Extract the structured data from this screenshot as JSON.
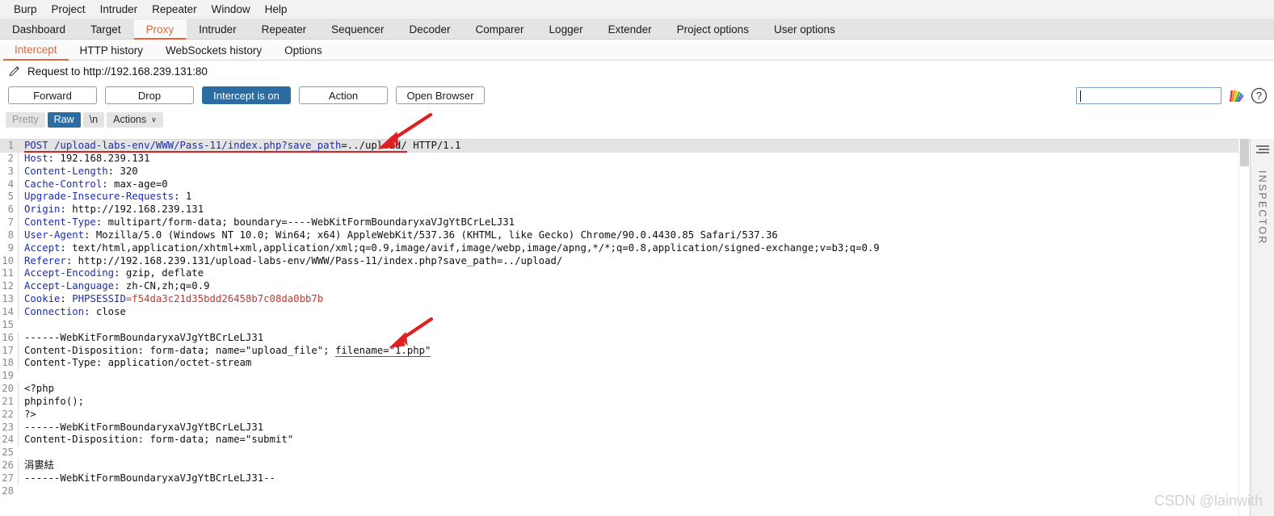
{
  "menubar": {
    "items": [
      "Burp",
      "Project",
      "Intruder",
      "Repeater",
      "Window",
      "Help"
    ]
  },
  "main_tabs": {
    "active": "Proxy",
    "items": [
      "Dashboard",
      "Target",
      "Proxy",
      "Intruder",
      "Repeater",
      "Sequencer",
      "Decoder",
      "Comparer",
      "Logger",
      "Extender",
      "Project options",
      "User options"
    ]
  },
  "sub_tabs": {
    "active": "Intercept",
    "items": [
      "Intercept",
      "HTTP history",
      "WebSockets history",
      "Options"
    ]
  },
  "request_title": {
    "icon": "pencil-icon",
    "text": "Request to http://192.168.239.131:80"
  },
  "buttons": {
    "forward": "Forward",
    "drop": "Drop",
    "intercept": "Intercept is on",
    "action": "Action",
    "open_browser": "Open Browser"
  },
  "search": {
    "value": "",
    "placeholder": "",
    "rainbow_icon": "rainbow-fan-icon",
    "help_icon": "help-question-icon"
  },
  "editor_toolbar": {
    "pretty": "Pretty",
    "raw": "Raw",
    "newline": "\\n",
    "actions": "Actions",
    "chevron": "∨",
    "active": "Raw"
  },
  "inspector": {
    "label": "INSPECTOR",
    "icon": "panel-lines-icon"
  },
  "colors": {
    "accent": "#e8653b",
    "primary_button": "#2b6ca3",
    "header_name": "#1c2db0",
    "cookie_value": "#c0392b",
    "annotation": "#e02020"
  },
  "watermark": "CSDN @lainwith",
  "request_lines": [
    {
      "n": 1,
      "highlight": true,
      "segments": [
        {
          "t": "POST /upload-labs-env/WWW/Pass-11/index.php?",
          "c": "hdr",
          "u": true
        },
        {
          "t": "save_path",
          "c": "hdr",
          "u": true
        },
        {
          "t": "=../upload/",
          "c": "val",
          "u": true
        },
        {
          "t": " HTTP/1.1",
          "c": "val",
          "u": false
        }
      ]
    },
    {
      "n": 2,
      "segments": [
        {
          "t": "Host",
          "c": "hdr"
        },
        {
          "t": ": 192.168.239.131",
          "c": "val"
        }
      ]
    },
    {
      "n": 3,
      "segments": [
        {
          "t": "Content-Length",
          "c": "hdr"
        },
        {
          "t": ": 320",
          "c": "val"
        }
      ]
    },
    {
      "n": 4,
      "segments": [
        {
          "t": "Cache-Control",
          "c": "hdr"
        },
        {
          "t": ": max-age=0",
          "c": "val"
        }
      ]
    },
    {
      "n": 5,
      "segments": [
        {
          "t": "Upgrade-Insecure-Requests",
          "c": "hdr"
        },
        {
          "t": ": 1",
          "c": "val"
        }
      ]
    },
    {
      "n": 6,
      "segments": [
        {
          "t": "Origin",
          "c": "hdr"
        },
        {
          "t": ": http://192.168.239.131",
          "c": "val"
        }
      ]
    },
    {
      "n": 7,
      "segments": [
        {
          "t": "Content-Type",
          "c": "hdr"
        },
        {
          "t": ": multipart/form-data; boundary=----WebKitFormBoundaryxaVJgYtBCrLeLJ31",
          "c": "val"
        }
      ]
    },
    {
      "n": 8,
      "segments": [
        {
          "t": "User-Agent",
          "c": "hdr"
        },
        {
          "t": ": Mozilla/5.0 (Windows NT 10.0; Win64; x64) AppleWebKit/537.36 (KHTML, like Gecko) Chrome/90.0.4430.85 Safari/537.36",
          "c": "val"
        }
      ]
    },
    {
      "n": 9,
      "segments": [
        {
          "t": "Accept",
          "c": "hdr"
        },
        {
          "t": ": text/html,application/xhtml+xml,application/xml;q=0.9,image/avif,image/webp,image/apng,*/*;q=0.8,application/signed-exchange;v=b3;q=0.9",
          "c": "val"
        }
      ]
    },
    {
      "n": 10,
      "segments": [
        {
          "t": "Referer",
          "c": "hdr"
        },
        {
          "t": ": http://192.168.239.131/upload-labs-env/WWW/Pass-11/index.php?save_path=../upload/",
          "c": "val"
        }
      ]
    },
    {
      "n": 11,
      "segments": [
        {
          "t": "Accept-Encoding",
          "c": "hdr"
        },
        {
          "t": ": gzip, deflate",
          "c": "val"
        }
      ]
    },
    {
      "n": 12,
      "segments": [
        {
          "t": "Accept-Language",
          "c": "hdr"
        },
        {
          "t": ": zh-CN,zh;q=0.9",
          "c": "val"
        }
      ]
    },
    {
      "n": 13,
      "segments": [
        {
          "t": "Cookie",
          "c": "hdr"
        },
        {
          "t": ": ",
          "c": "val"
        },
        {
          "t": "PHPSESSID",
          "c": "hdr"
        },
        {
          "t": "=f54da3c21d35bdd26458b7c08da0bb7b",
          "c": "red"
        }
      ]
    },
    {
      "n": 14,
      "segments": [
        {
          "t": "Connection",
          "c": "hdr"
        },
        {
          "t": ": close",
          "c": "val"
        }
      ]
    },
    {
      "n": 15,
      "segments": [
        {
          "t": "",
          "c": "val"
        }
      ]
    },
    {
      "n": 16,
      "segments": [
        {
          "t": "------WebKitFormBoundaryxaVJgYtBCrLeLJ31",
          "c": "val"
        }
      ]
    },
    {
      "n": 17,
      "segments": [
        {
          "t": "Content-Disposition: form-data; name=\"upload_file\"; ",
          "c": "val"
        },
        {
          "t": "filename=\"1.php\"",
          "c": "val",
          "u": true
        }
      ]
    },
    {
      "n": 18,
      "segments": [
        {
          "t": "Content-Type: application/octet-stream",
          "c": "val"
        }
      ]
    },
    {
      "n": 19,
      "segments": [
        {
          "t": "",
          "c": "val"
        }
      ]
    },
    {
      "n": 20,
      "segments": [
        {
          "t": "<?php",
          "c": "val"
        }
      ]
    },
    {
      "n": 21,
      "segments": [
        {
          "t": "phpinfo();",
          "c": "val"
        }
      ]
    },
    {
      "n": 22,
      "segments": [
        {
          "t": "?>",
          "c": "val"
        }
      ]
    },
    {
      "n": 23,
      "segments": [
        {
          "t": "------WebKitFormBoundaryxaVJgYtBCrLeLJ31",
          "c": "val"
        }
      ]
    },
    {
      "n": 24,
      "segments": [
        {
          "t": "Content-Disposition: form-data; name=\"submit\"",
          "c": "val"
        }
      ]
    },
    {
      "n": 25,
      "segments": [
        {
          "t": "",
          "c": "val"
        }
      ]
    },
    {
      "n": 26,
      "segments": [
        {
          "t": "涓婁紶",
          "c": "val"
        }
      ]
    },
    {
      "n": 27,
      "segments": [
        {
          "t": "------WebKitFormBoundaryxaVJgYtBCrLeLJ31--",
          "c": "val"
        }
      ]
    },
    {
      "n": 28,
      "segments": [
        {
          "t": "",
          "c": "val"
        }
      ]
    }
  ]
}
